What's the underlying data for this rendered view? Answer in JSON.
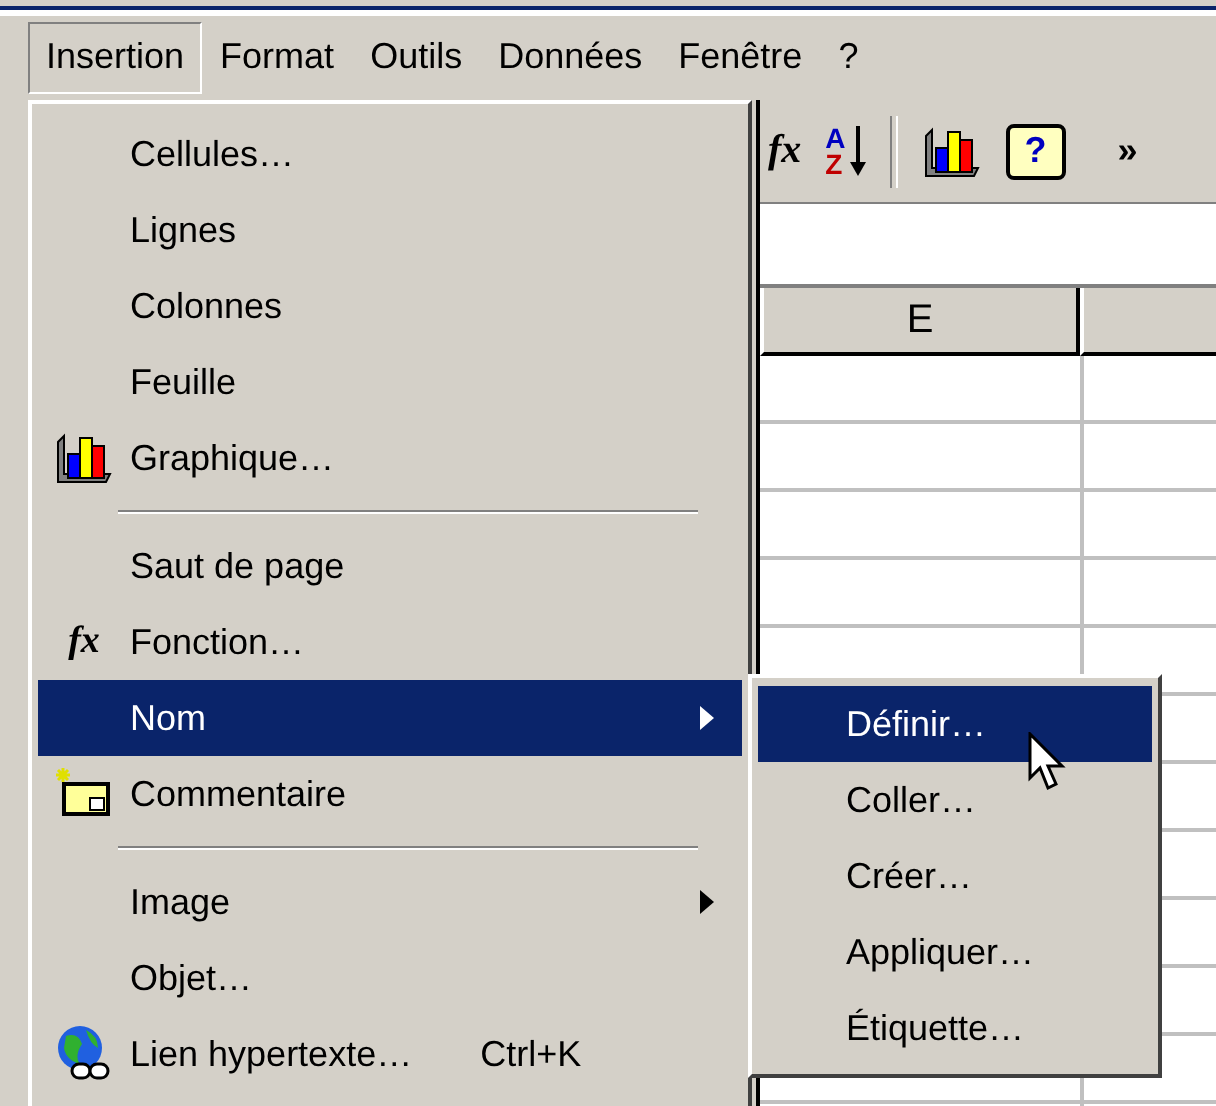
{
  "menubar": [
    {
      "label": "Insertion",
      "selected": true
    },
    {
      "label": "Format",
      "selected": false
    },
    {
      "label": "Outils",
      "selected": false
    },
    {
      "label": "Données",
      "selected": false
    },
    {
      "label": "Fenêtre",
      "selected": false
    },
    {
      "label": "?",
      "selected": false
    }
  ],
  "toolbar": [
    {
      "kind": "function",
      "glyph": "fx"
    },
    {
      "kind": "sort",
      "glyph": "A",
      "glyph_2": "Z"
    },
    {
      "kind": "separator"
    },
    {
      "kind": "chart"
    },
    {
      "kind": "help",
      "glyph": "?"
    },
    {
      "kind": "more",
      "glyph": "»"
    }
  ],
  "sheet": {
    "columns": [
      "E"
    ]
  },
  "menu": {
    "items": [
      {
        "kind": "plain",
        "label": "Cellules…",
        "selected": false
      },
      {
        "kind": "plain",
        "label": "Lignes",
        "selected": false
      },
      {
        "kind": "plain",
        "label": "Colonnes",
        "selected": false
      },
      {
        "kind": "plain",
        "label": "Feuille",
        "selected": false
      },
      {
        "kind": "chart",
        "label": "Graphique…",
        "selected": false
      },
      {
        "kind": "separator"
      },
      {
        "kind": "plain",
        "label": "Saut de page",
        "selected": false
      },
      {
        "kind": "function",
        "label": "Fonction…",
        "glyph": "fx",
        "selected": false
      },
      {
        "kind": "plain",
        "label": "Nom",
        "has_submenu": true,
        "selected": true
      },
      {
        "kind": "comment",
        "label": "Commentaire",
        "selected": false
      },
      {
        "kind": "separator"
      },
      {
        "kind": "plain",
        "label": "Image",
        "has_submenu": true,
        "selected": false
      },
      {
        "kind": "plain",
        "label": "Objet…",
        "selected": false
      },
      {
        "kind": "hyperlink",
        "label": "Lien hypertexte…",
        "shortcut": "Ctrl+K",
        "selected": false
      }
    ]
  },
  "submenu": {
    "items": [
      {
        "label": "Définir…",
        "selected": true
      },
      {
        "label": "Coller…",
        "selected": false
      },
      {
        "label": "Créer…",
        "selected": false
      },
      {
        "label": "Appliquer…",
        "selected": false
      },
      {
        "label": "Étiquette…",
        "selected": false
      }
    ]
  }
}
